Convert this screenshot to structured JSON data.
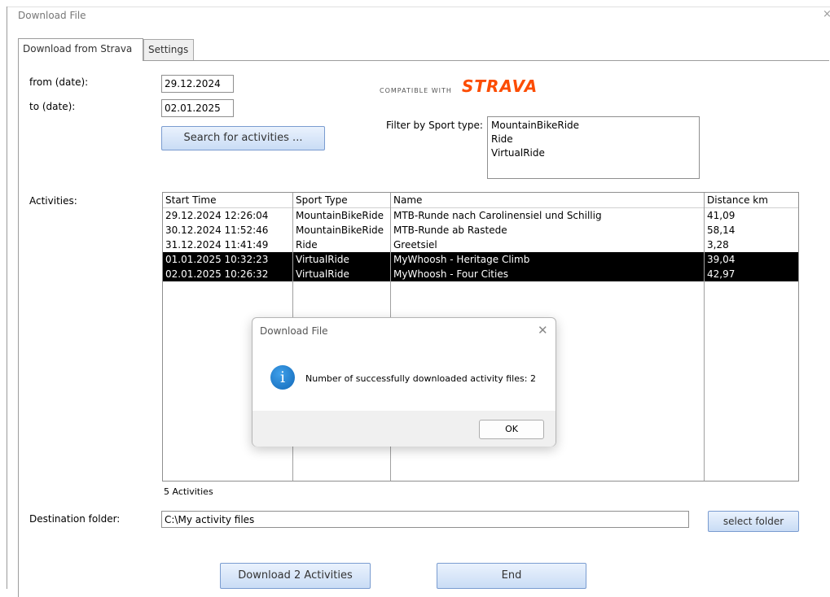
{
  "window": {
    "title": "Download File",
    "close_glyph": "×"
  },
  "tabs": [
    {
      "label": "Download from Strava",
      "active": true
    },
    {
      "label": "Settings",
      "active": false
    }
  ],
  "form": {
    "from_label": "from (date):",
    "from_value": "29.12.2024",
    "to_label": "to (date):",
    "to_value": "02.01.2025",
    "search_button": "Search for activities ..."
  },
  "strava": {
    "small_text": "COMPATIBLE WITH",
    "brand": "STRAVA",
    "brand_color": "#fc4c02"
  },
  "sport_filter": {
    "label": "Filter by Sport type:",
    "options": [
      "MountainBikeRide",
      "Ride",
      "VirtualRide"
    ]
  },
  "activities": {
    "label": "Activities:",
    "columns": [
      "Start Time",
      "Sport Type",
      "Name",
      "Distance km"
    ],
    "rows": [
      {
        "start": "29.12.2024 12:26:04",
        "sport": "MountainBikeRide",
        "name": "MTB-Runde nach Carolinensiel und Schillig",
        "distance": "41,09",
        "selected": false
      },
      {
        "start": "30.12.2024 11:52:46",
        "sport": "MountainBikeRide",
        "name": "MTB-Runde ab Rastede",
        "distance": "58,14",
        "selected": false
      },
      {
        "start": "31.12.2024 11:41:49",
        "sport": "Ride",
        "name": "Greetsiel",
        "distance": "3,28",
        "selected": false
      },
      {
        "start": "01.01.2025 10:32:23",
        "sport": "VirtualRide",
        "name": "MyWhoosh - Heritage Climb",
        "distance": "39,04",
        "selected": true
      },
      {
        "start": "02.01.2025 10:26:32",
        "sport": "VirtualRide",
        "name": "MyWhoosh - Four Cities",
        "distance": "42,97",
        "selected": true
      }
    ],
    "count_text": "5 Activities"
  },
  "destination": {
    "label": "Destination folder:",
    "value": "C:\\My activity files",
    "select_button": "select folder"
  },
  "actions": {
    "download_button": "Download 2 Activities",
    "end_button": "End"
  },
  "dialog": {
    "title": "Download File",
    "close_glyph": "✕",
    "icon": "info-icon",
    "icon_glyph": "i",
    "message": "Number of successfully downloaded activity files: 2",
    "ok_label": "OK"
  }
}
